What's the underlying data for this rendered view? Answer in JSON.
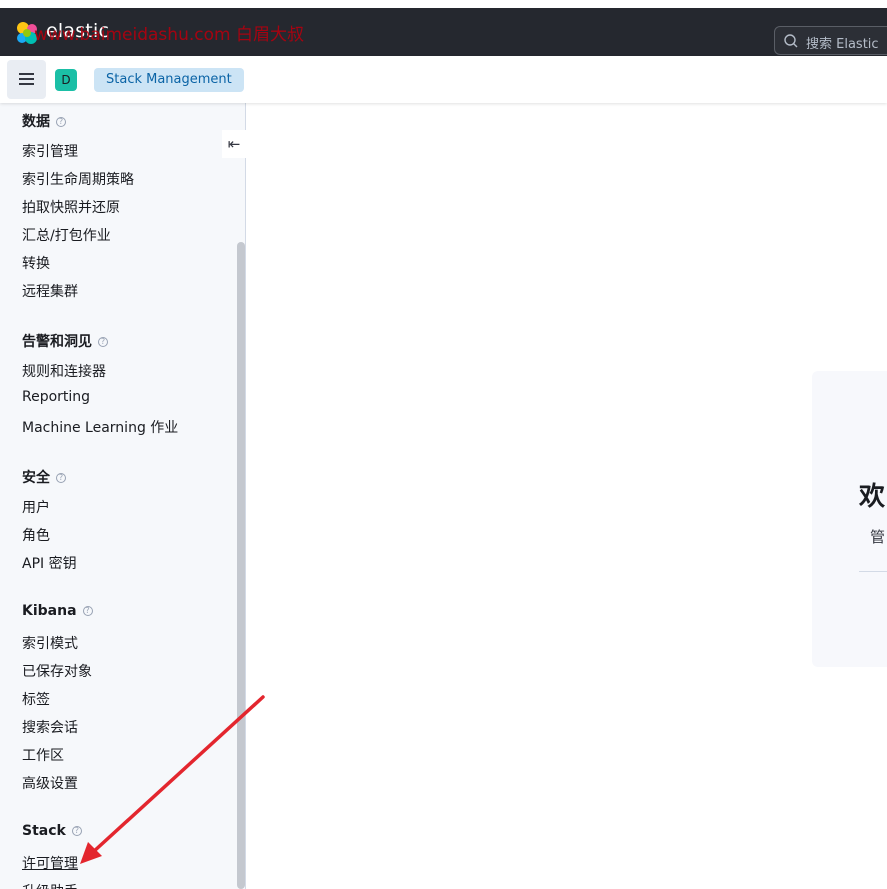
{
  "header": {
    "logo_text": "elastic",
    "watermark": "www.baimeidashu.com 白眉大叔",
    "search_placeholder": "搜索 Elastic"
  },
  "subheader": {
    "space_initial": "D",
    "breadcrumb": "Stack Management"
  },
  "sidebar": {
    "collapse_glyph": "⇤",
    "sections": [
      {
        "title": "数据",
        "items": [
          "索引管理",
          "索引生命周期策略",
          "拍取快照并还原",
          "汇总/打包作业",
          "转换",
          "远程集群"
        ]
      },
      {
        "title": "告警和洞见",
        "items": [
          "规则和连接器",
          "Reporting",
          "Machine Learning 作业"
        ]
      },
      {
        "title": "安全",
        "items": [
          "用户",
          "角色",
          "API 密钥"
        ]
      },
      {
        "title": "Kibana",
        "items": [
          "索引模式",
          "已保存对象",
          "标签",
          "搜索会话",
          "工作区",
          "高级设置"
        ]
      },
      {
        "title": "Stack",
        "items": [
          "许可管理",
          "升级助手"
        ]
      }
    ]
  },
  "main": {
    "welcome_title": "欢",
    "welcome_sub": "管"
  },
  "colors": {
    "header_bg": "#25282f",
    "breadcrumb_bg": "#cce4f5",
    "space_badge": "#1bbfa6",
    "annotation_arrow": "#e3262e"
  }
}
